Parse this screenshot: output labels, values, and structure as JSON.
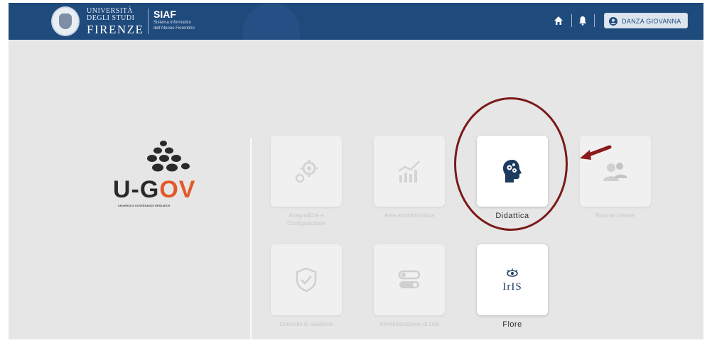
{
  "header": {
    "university_line1": "UNIVERSITÀ",
    "university_line2": "DEGLI STUDI",
    "university_line3": "FIRENZE",
    "siaf_name": "SIAF",
    "siaf_sub1": "Sistema Informatico",
    "siaf_sub2": "dell'Ateneo Fiorentino",
    "user_name": "DANZA GIOVANNA",
    "icons": [
      "home-icon",
      "bell-icon",
      "user-icon"
    ]
  },
  "logo": {
    "word_main": "U-G",
    "word_accent": "OV",
    "tagline": "UNIVERSITA GOVERNANCE RESEARCH",
    "accent_color": "#e2592a"
  },
  "tiles": [
    {
      "label_line1": "Anagrafiche e",
      "label_line2": "Configurazione",
      "icon": "gears-icon",
      "active": false
    },
    {
      "label_line1": "Area amministrativa",
      "label_line2": "",
      "icon": "bar-chart-icon",
      "active": false
    },
    {
      "label_line1": "Didattica",
      "label_line2": "",
      "icon": "brain-head-icon",
      "active": true
    },
    {
      "label_line1": "Risorse Umane",
      "label_line2": "",
      "icon": "people-icon",
      "active": false
    },
    {
      "label_line1": "Controllo di Gestione",
      "label_line2": "",
      "icon": "shield-check-icon",
      "active": false
    },
    {
      "label_line1": "Amministrazione di Dati",
      "label_line2": "",
      "icon": "toggles-icon",
      "active": false
    },
    {
      "label_line1": "Flore",
      "label_line2": "",
      "icon": "iris-icon",
      "active": true
    }
  ],
  "colors": {
    "header_bg": "#1f4a7c",
    "page_bg": "#e6e6e6",
    "highlight": "#7a1a1a",
    "icon_dark": "#1d3a5f"
  }
}
